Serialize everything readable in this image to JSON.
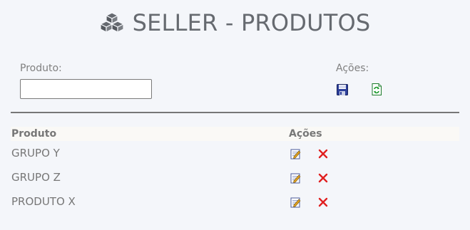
{
  "header": {
    "title": "SELLER - PRODUTOS",
    "icon": "cubes-icon"
  },
  "filter": {
    "produto_label": "Produto:",
    "produto_value": "",
    "produto_placeholder": "",
    "acoes_label": "Ações:"
  },
  "table": {
    "columns": [
      "Produto",
      "Ações"
    ],
    "rows": [
      {
        "name": "GRUPO Y"
      },
      {
        "name": "GRUPO Z"
      },
      {
        "name": "PRODUTO X"
      }
    ]
  },
  "colors": {
    "background": "#f4f6fa",
    "title": "#666a70",
    "text": "#777777",
    "delete": "#e02020",
    "refresh": "#1a9a2a",
    "save": "#2c3f9a"
  }
}
